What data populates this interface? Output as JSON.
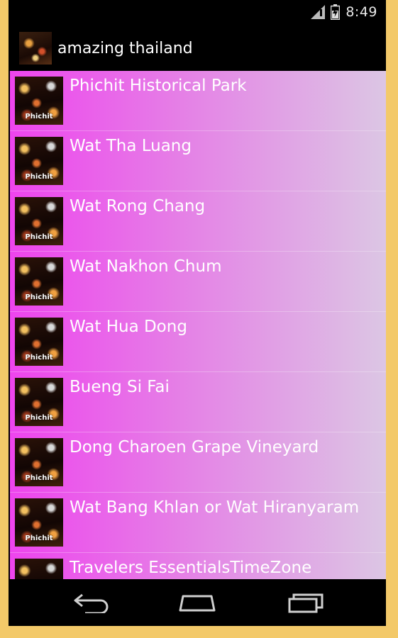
{
  "statusbar": {
    "time": "8:49"
  },
  "app": {
    "title": "amazing thailand"
  },
  "list": {
    "thumbnail_caption": "Phichit",
    "items": [
      {
        "label": "Phichit Historical Park"
      },
      {
        "label": "Wat Tha Luang"
      },
      {
        "label": "Wat Rong Chang"
      },
      {
        "label": "Wat Nakhon Chum"
      },
      {
        "label": "Wat Hua Dong"
      },
      {
        "label": "Bueng Si Fai"
      },
      {
        "label": "Dong Charoen Grape Vineyard"
      },
      {
        "label": "Wat Bang Khlan or Wat Hiranyaram"
      },
      {
        "label": "Travelers EssentialsTimeZone"
      }
    ]
  },
  "icons": {
    "back": "back-icon",
    "home": "home-icon",
    "recents": "recents-icon"
  }
}
